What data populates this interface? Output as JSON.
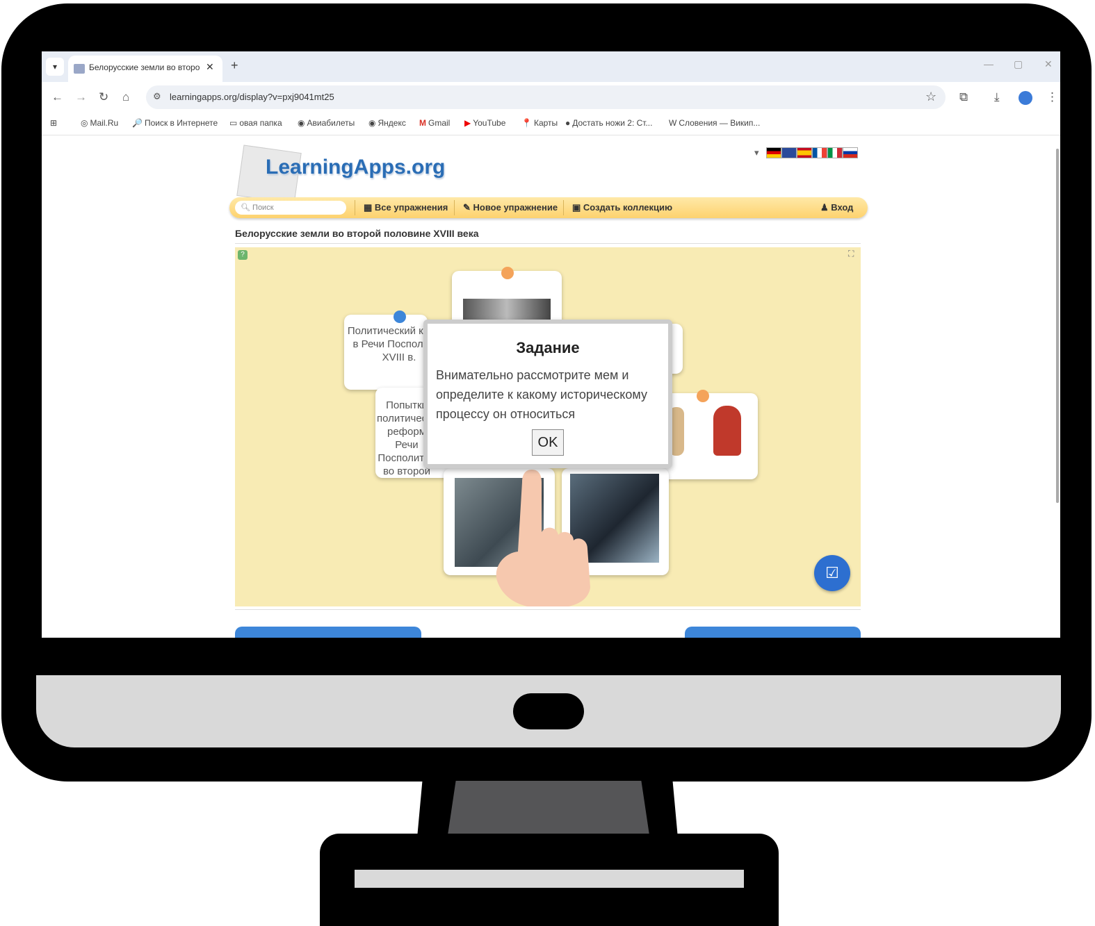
{
  "browser": {
    "tab_title": "Белорусские земли во второй",
    "tab_close": "✕",
    "new_tab": "+",
    "url": "learningapps.org/display?v=pxj9041mt25",
    "bookmarks": [
      {
        "icon": "◎",
        "label": "Mail.Ru"
      },
      {
        "icon": "🔎",
        "label": "Поиск в Интернете"
      },
      {
        "icon": "▭",
        "label": "овая папка"
      },
      {
        "icon": "◉",
        "label": "Авиабилеты"
      },
      {
        "icon": "◉",
        "label": "Яндекс"
      },
      {
        "icon": "M",
        "label": "Gmail"
      },
      {
        "icon": "▶",
        "label": "YouTube"
      },
      {
        "icon": "📍",
        "label": "Карты"
      },
      {
        "icon": "●",
        "label": "Достать ножи 2: Ст..."
      },
      {
        "icon": "W",
        "label": "Словения — Викип..."
      }
    ]
  },
  "site": {
    "logo": "LearningApps.org",
    "search_placeholder": "Поиск",
    "nav": {
      "all": "Все упражнения",
      "new": "Новое упражнение",
      "collection": "Создать коллекцию",
      "login": "Вход"
    },
    "page_title": "Белорусские земли во второй половине XVIII века"
  },
  "exercise": {
    "card1": "Политический кризис в Речи Посполитой XVIII в.",
    "card2": "Попытки политических реформ Речи Посполитой во второй половине XVIII в."
  },
  "dialog": {
    "title": "Задание",
    "body": "Внимательно рассмотрите мем и определите к какому историческому процессу он относиться",
    "ok": "OK"
  },
  "colors": {
    "accent": "#2d6fd0",
    "nav_bar": "#fdd26e",
    "exercise_bg": "#f8ebb4"
  }
}
